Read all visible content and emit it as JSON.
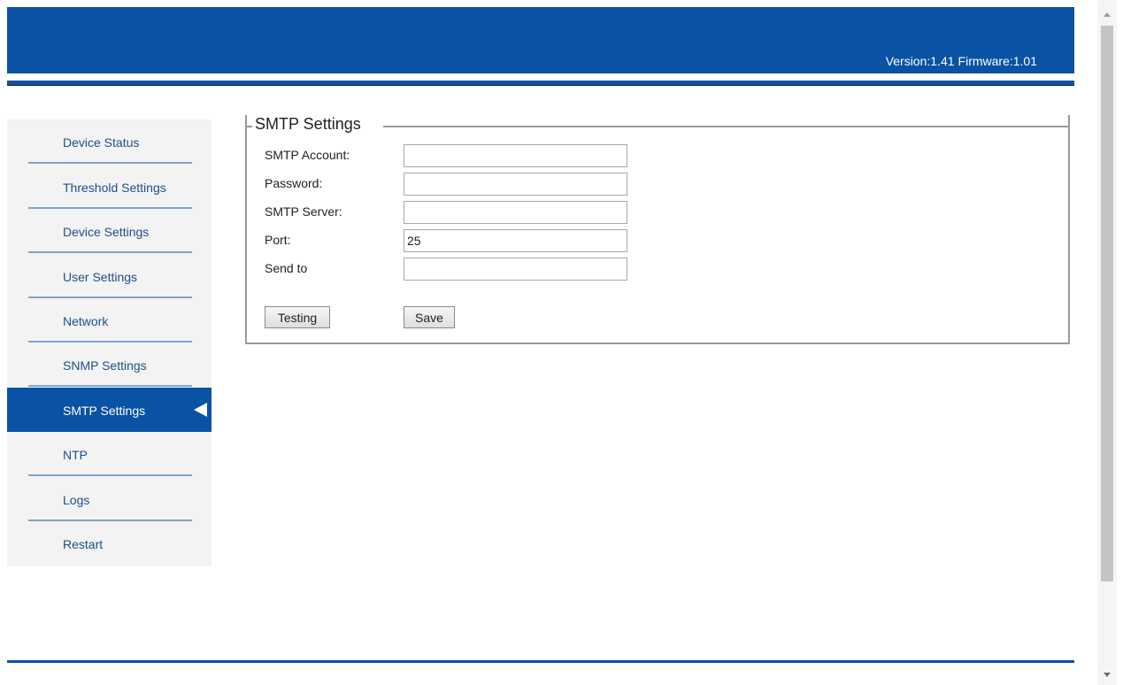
{
  "header": {
    "version_text": "Version:1.41",
    "firmware_text": "Firmware:1.01",
    "color": "#0a52a4"
  },
  "sidebar": {
    "items": [
      {
        "label": "Device Status",
        "active": false
      },
      {
        "label": "Threshold Settings",
        "active": false
      },
      {
        "label": "Device Settings",
        "active": false
      },
      {
        "label": "User Settings",
        "active": false
      },
      {
        "label": "Network",
        "active": false
      },
      {
        "label": "SNMP Settings",
        "active": false
      },
      {
        "label": "SMTP Settings",
        "active": true
      },
      {
        "label": "NTP",
        "active": false
      },
      {
        "label": "Logs",
        "active": false
      },
      {
        "label": "Restart",
        "active": false
      }
    ],
    "active_indicator_icon": "triangle-left-icon"
  },
  "smtp_form": {
    "legend": "SMTP Settings",
    "fields": [
      {
        "label": "SMTP Account:",
        "value": ""
      },
      {
        "label": "Password:",
        "value": ""
      },
      {
        "label": "SMTP Server:",
        "value": ""
      },
      {
        "label": "Port:",
        "value": "25"
      },
      {
        "label": "Send to",
        "value": ""
      }
    ],
    "testing_button": "Testing",
    "save_button": "Save"
  }
}
